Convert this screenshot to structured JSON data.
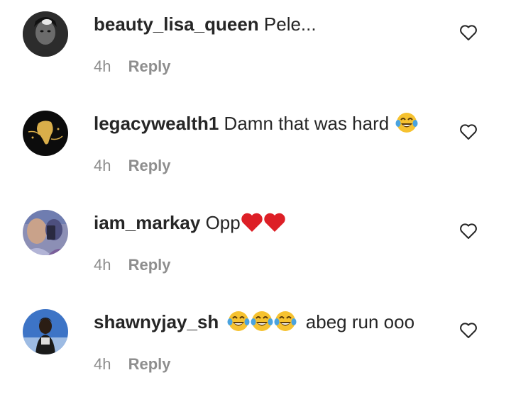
{
  "comments": [
    {
      "username": "beauty_lisa_queen",
      "text": "Pele...",
      "emojis": [],
      "time": "4h",
      "reply_label": "Reply",
      "avatar_icon": "profile-photo-woman"
    },
    {
      "username": "legacywealth1",
      "text": "Damn that was hard",
      "emojis": [
        "face-with-tears-of-joy"
      ],
      "time": "4h",
      "reply_label": "Reply",
      "avatar_icon": "profile-photo-africa-map-logo"
    },
    {
      "username": "iam_markay",
      "text": "Opp",
      "emojis": [
        "red-heart",
        "red-heart"
      ],
      "time": "4h",
      "reply_label": "Reply",
      "avatar_icon": "profile-photo-person-selfie"
    },
    {
      "username": "shawnyjay_sh",
      "text": "abeg run ooo",
      "emojis": [
        "face-with-tears-of-joy",
        "face-with-tears-of-joy",
        "face-with-tears-of-joy"
      ],
      "time": "4h",
      "reply_label": "Reply",
      "avatar_icon": "profile-photo-person-blue-background"
    }
  ],
  "icons": {
    "like": "heart-outline-icon"
  },
  "colors": {
    "text": "#262626",
    "secondary": "#8e8e8e",
    "emoji_yellow": "#f6c230",
    "heart_red": "#dd1f26"
  }
}
